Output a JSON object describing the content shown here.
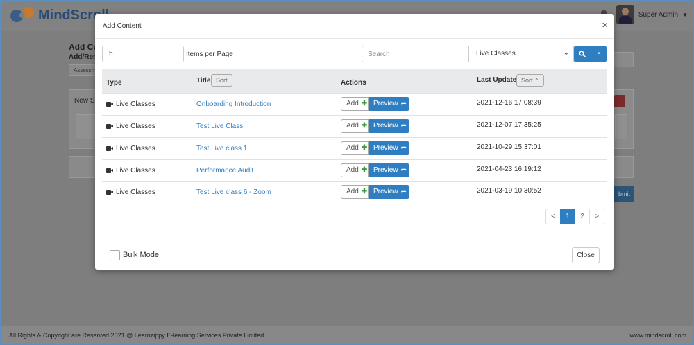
{
  "app": {
    "logo_text": "MindScroll",
    "user_name": "Super Admin"
  },
  "background": {
    "page_title": "Add Co",
    "page_subtitle": "Add/Rem",
    "input_value": "Assessm",
    "card_label": "New Se",
    "submit_label": "bmit"
  },
  "footer": {
    "copyright": "All Rights & Copyright are Reserved 2021 @ Learnzippy E-learning Services Private Limited",
    "website": "www.mindscroll.com"
  },
  "modal": {
    "title": "Add Content",
    "close_icon": "×",
    "items_per_page_value": "5",
    "items_per_page_label": "Items per Page",
    "search_placeholder": "Search",
    "type_selected": "Live Classes",
    "clear_label": "×",
    "columns": {
      "type": "Type",
      "title": "Title",
      "actions": "Actions",
      "last_updated": "Last Updated",
      "sort": "Sort"
    },
    "add_label": "Add",
    "preview_label": "Preview",
    "rows": [
      {
        "type": "Live Classes",
        "title": "Onboarding Introduction",
        "updated": "2021-12-16 17:08:39"
      },
      {
        "type": "Live Classes",
        "title": "Test Live Class",
        "updated": "2021-12-07 17:35:25"
      },
      {
        "type": "Live Classes",
        "title": "Test Live class 1",
        "updated": "2021-10-29 15:37:01"
      },
      {
        "type": "Live Classes",
        "title": "Performance Audit",
        "updated": "2021-04-23 16:19:12"
      },
      {
        "type": "Live Classes",
        "title": "Test Live class 6 - Zoom",
        "updated": "2021-03-19 10:30:52"
      }
    ],
    "pagination": {
      "prev": "<",
      "pages": [
        "1",
        "2"
      ],
      "next": ">",
      "current": "1"
    },
    "bulk_mode_label": "Bulk Mode",
    "close_label": "Close"
  }
}
